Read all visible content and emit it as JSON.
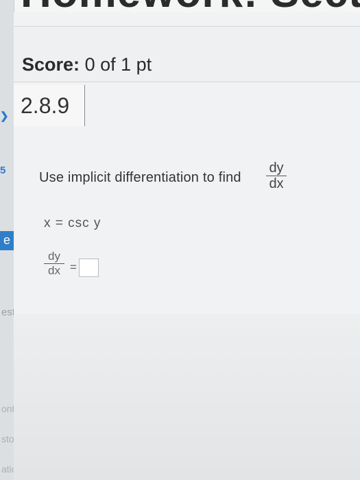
{
  "header": {
    "banner_text": "Homework: Section"
  },
  "sidebar": {
    "e_tab": "e",
    "test_label": "est",
    "faint_1": "onte",
    "faint_2": "stor",
    "faint_3": "atio"
  },
  "score": {
    "label": "Score:",
    "value": "0 of 1 pt"
  },
  "question": {
    "number": "2.8.9",
    "prompt": "Use implicit differentiation to find",
    "find": {
      "numerator": "dy",
      "denominator": "dx"
    },
    "equation": "x = csc  y",
    "answer": {
      "numerator": "dy",
      "denominator": "dx",
      "equals": "=",
      "value": ""
    }
  }
}
